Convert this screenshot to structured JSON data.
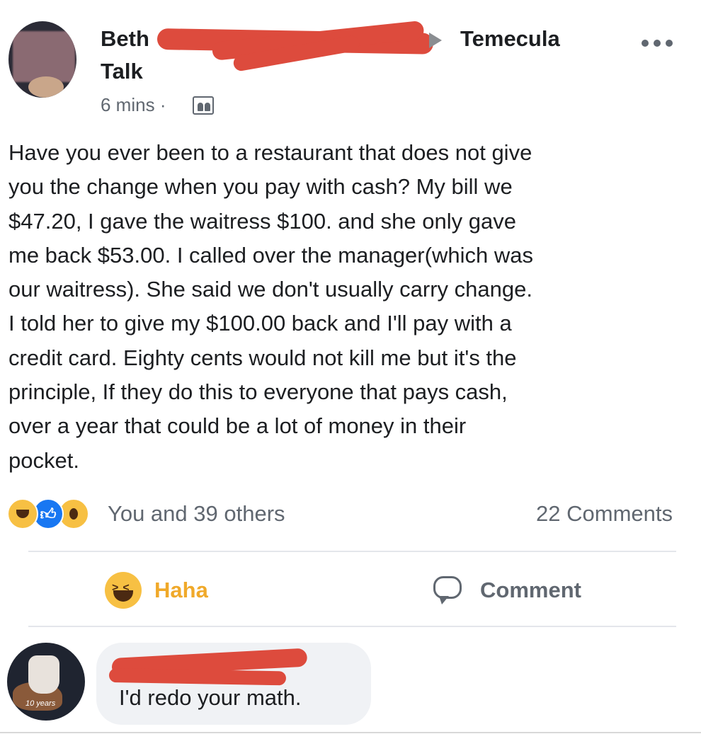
{
  "post": {
    "author_name": "Beth",
    "group_name": "Temecula",
    "group_name_cont": "Talk",
    "time": "6 mins",
    "separator": "·",
    "body": "Have you ever been to a restaurant that does not give\nyou the change when you pay with cash? My bill we\n$47.20, I gave the waitress $100. and she only gave\nme back $53.00. I called over the manager(which was\nour waitress). She said we don't usually carry change.\nI told her to give my $100.00 back and I'll pay with a\ncredit card. Eighty cents would not kill me but it's the\nprinciple, If they do this to everyone that pays cash,\nover a year that could be a lot of money in their\npocket.",
    "reactions_text": "You and 39 others",
    "comments_count": "22 Comments"
  },
  "actions": {
    "haha_label": "Haha",
    "comment_label": "Comment"
  },
  "comment": {
    "text": "I'd redo your math.",
    "avatar_tag": "10 years"
  },
  "icons": {
    "more": "more-options-icon",
    "audience": "audience-friends-icon",
    "reactions": [
      "haha-reaction-icon",
      "like-reaction-icon",
      "wow-reaction-icon"
    ],
    "comment": "comment-bubble-icon"
  },
  "colors": {
    "redaction": "#dd4b3d",
    "like_blue": "#1877f2",
    "haha_yellow": "#f7c043",
    "haha_label": "#f0a92a",
    "secondary_text": "#606770"
  }
}
